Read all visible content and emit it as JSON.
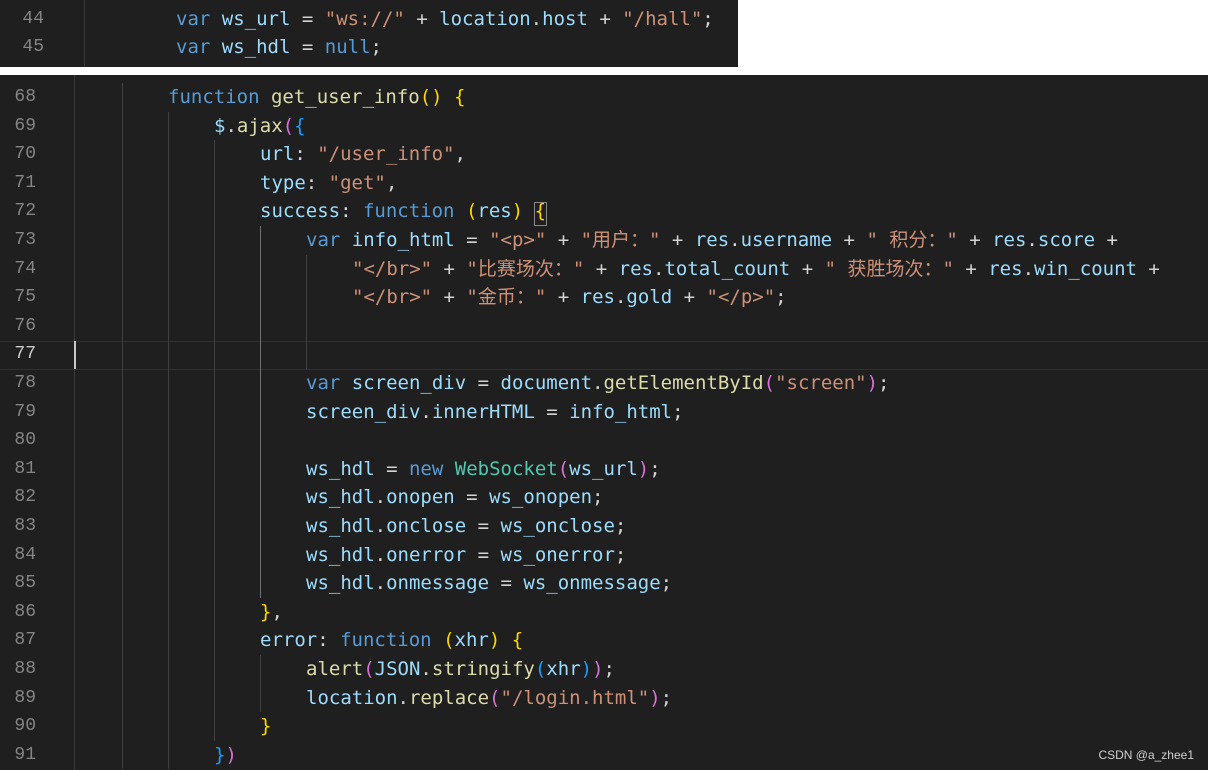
{
  "top_panel": {
    "lines": [
      {
        "n": "44",
        "indent": 8,
        "tokens": [
          {
            "t": "var",
            "c": "kw"
          },
          {
            "t": " "
          },
          {
            "t": "ws_url",
            "c": "var"
          },
          {
            "t": " = "
          },
          {
            "t": "\"ws://\"",
            "c": "str"
          },
          {
            "t": " + "
          },
          {
            "t": "location",
            "c": "var"
          },
          {
            "t": "."
          },
          {
            "t": "host",
            "c": "var"
          },
          {
            "t": " + "
          },
          {
            "t": "\"/hall\"",
            "c": "str"
          },
          {
            "t": ";"
          }
        ]
      },
      {
        "n": "45",
        "indent": 8,
        "tokens": [
          {
            "t": "var",
            "c": "kw"
          },
          {
            "t": " "
          },
          {
            "t": "ws_hdl",
            "c": "var"
          },
          {
            "t": " = "
          },
          {
            "t": "null",
            "c": "kw"
          },
          {
            "t": ";"
          }
        ]
      }
    ]
  },
  "main_panel": {
    "lines": [
      {
        "n": "68",
        "indent": 8,
        "tokens": [
          {
            "t": "function",
            "c": "kw"
          },
          {
            "t": " "
          },
          {
            "t": "get_user_info",
            "c": "fn"
          },
          {
            "t": "()",
            "c": "b1"
          },
          {
            "t": " "
          },
          {
            "t": "{",
            "c": "b1"
          }
        ]
      },
      {
        "n": "69",
        "indent": 12,
        "tokens": [
          {
            "t": "$",
            "c": "var"
          },
          {
            "t": "."
          },
          {
            "t": "ajax",
            "c": "fn"
          },
          {
            "t": "(",
            "c": "b2"
          },
          {
            "t": "{",
            "c": "b3"
          }
        ]
      },
      {
        "n": "70",
        "indent": 16,
        "tokens": [
          {
            "t": "url",
            "c": "var"
          },
          {
            "t": ": "
          },
          {
            "t": "\"/user_info\"",
            "c": "str"
          },
          {
            "t": ","
          }
        ]
      },
      {
        "n": "71",
        "indent": 16,
        "tokens": [
          {
            "t": "type",
            "c": "var"
          },
          {
            "t": ": "
          },
          {
            "t": "\"get\"",
            "c": "str"
          },
          {
            "t": ","
          }
        ]
      },
      {
        "n": "72",
        "indent": 16,
        "tokens": [
          {
            "t": "success",
            "c": "var"
          },
          {
            "t": ": "
          },
          {
            "t": "function",
            "c": "kw"
          },
          {
            "t": " "
          },
          {
            "t": "(",
            "c": "b1"
          },
          {
            "t": "res",
            "c": "var"
          },
          {
            "t": ")",
            "c": "b1"
          },
          {
            "t": " "
          },
          {
            "t": "{",
            "c": "b1",
            "box": true
          }
        ]
      },
      {
        "n": "73",
        "indent": 20,
        "tokens": [
          {
            "t": "var",
            "c": "kw"
          },
          {
            "t": " "
          },
          {
            "t": "info_html",
            "c": "var"
          },
          {
            "t": " = "
          },
          {
            "t": "\"<p>\"",
            "c": "str"
          },
          {
            "t": " + "
          },
          {
            "t": "\"用户：\"",
            "c": "str"
          },
          {
            "t": " + "
          },
          {
            "t": "res",
            "c": "var"
          },
          {
            "t": "."
          },
          {
            "t": "username",
            "c": "var"
          },
          {
            "t": " + "
          },
          {
            "t": "\" 积分：\"",
            "c": "str"
          },
          {
            "t": " + "
          },
          {
            "t": "res",
            "c": "var"
          },
          {
            "t": "."
          },
          {
            "t": "score",
            "c": "var"
          },
          {
            "t": " +"
          }
        ]
      },
      {
        "n": "74",
        "indent": 24,
        "tokens": [
          {
            "t": "\"</br>\"",
            "c": "str"
          },
          {
            "t": " + "
          },
          {
            "t": "\"比赛场次：\"",
            "c": "str"
          },
          {
            "t": " + "
          },
          {
            "t": "res",
            "c": "var"
          },
          {
            "t": "."
          },
          {
            "t": "total_count",
            "c": "var"
          },
          {
            "t": " + "
          },
          {
            "t": "\" 获胜场次：\"",
            "c": "str"
          },
          {
            "t": " + "
          },
          {
            "t": "res",
            "c": "var"
          },
          {
            "t": "."
          },
          {
            "t": "win_count",
            "c": "var"
          },
          {
            "t": " +"
          }
        ]
      },
      {
        "n": "75",
        "indent": 24,
        "tokens": [
          {
            "t": "\"</br>\"",
            "c": "str"
          },
          {
            "t": " + "
          },
          {
            "t": "\"金币：\"",
            "c": "str"
          },
          {
            "t": " + "
          },
          {
            "t": "res",
            "c": "var"
          },
          {
            "t": "."
          },
          {
            "t": "gold",
            "c": "var"
          },
          {
            "t": " + "
          },
          {
            "t": "\"</p>\"",
            "c": "str"
          },
          {
            "t": ";"
          }
        ]
      },
      {
        "n": "76",
        "indent": 0,
        "tokens": []
      },
      {
        "n": "77",
        "indent": 0,
        "tokens": []
      },
      {
        "n": "78",
        "indent": 20,
        "tokens": [
          {
            "t": "var",
            "c": "kw"
          },
          {
            "t": " "
          },
          {
            "t": "screen_div",
            "c": "var"
          },
          {
            "t": " = "
          },
          {
            "t": "document",
            "c": "var"
          },
          {
            "t": "."
          },
          {
            "t": "getElementById",
            "c": "fn"
          },
          {
            "t": "(",
            "c": "b2"
          },
          {
            "t": "\"screen\"",
            "c": "str"
          },
          {
            "t": ")",
            "c": "b2"
          },
          {
            "t": ";"
          }
        ]
      },
      {
        "n": "79",
        "indent": 20,
        "tokens": [
          {
            "t": "screen_div",
            "c": "var"
          },
          {
            "t": "."
          },
          {
            "t": "innerHTML",
            "c": "var"
          },
          {
            "t": " = "
          },
          {
            "t": "info_html",
            "c": "var"
          },
          {
            "t": ";"
          }
        ]
      },
      {
        "n": "80",
        "indent": 0,
        "tokens": []
      },
      {
        "n": "81",
        "indent": 20,
        "tokens": [
          {
            "t": "ws_hdl",
            "c": "var"
          },
          {
            "t": " = "
          },
          {
            "t": "new",
            "c": "kw"
          },
          {
            "t": " "
          },
          {
            "t": "WebSocket",
            "c": "cls"
          },
          {
            "t": "(",
            "c": "b2"
          },
          {
            "t": "ws_url",
            "c": "var"
          },
          {
            "t": ")",
            "c": "b2"
          },
          {
            "t": ";"
          }
        ]
      },
      {
        "n": "82",
        "indent": 20,
        "tokens": [
          {
            "t": "ws_hdl",
            "c": "var"
          },
          {
            "t": "."
          },
          {
            "t": "onopen",
            "c": "var"
          },
          {
            "t": " = "
          },
          {
            "t": "ws_onopen",
            "c": "var"
          },
          {
            "t": ";"
          }
        ]
      },
      {
        "n": "83",
        "indent": 20,
        "tokens": [
          {
            "t": "ws_hdl",
            "c": "var"
          },
          {
            "t": "."
          },
          {
            "t": "onclose",
            "c": "var"
          },
          {
            "t": " = "
          },
          {
            "t": "ws_onclose",
            "c": "var"
          },
          {
            "t": ";"
          }
        ]
      },
      {
        "n": "84",
        "indent": 20,
        "tokens": [
          {
            "t": "ws_hdl",
            "c": "var"
          },
          {
            "t": "."
          },
          {
            "t": "onerror",
            "c": "var"
          },
          {
            "t": " = "
          },
          {
            "t": "ws_onerror",
            "c": "var"
          },
          {
            "t": ";"
          }
        ]
      },
      {
        "n": "85",
        "indent": 20,
        "tokens": [
          {
            "t": "ws_hdl",
            "c": "var"
          },
          {
            "t": "."
          },
          {
            "t": "onmessage",
            "c": "var"
          },
          {
            "t": " = "
          },
          {
            "t": "ws_onmessage",
            "c": "var"
          },
          {
            "t": ";"
          }
        ]
      },
      {
        "n": "86",
        "indent": 16,
        "tokens": [
          {
            "t": "}",
            "c": "b1",
            "box": true
          },
          {
            "t": ","
          }
        ]
      },
      {
        "n": "87",
        "indent": 16,
        "tokens": [
          {
            "t": "error",
            "c": "var"
          },
          {
            "t": ": "
          },
          {
            "t": "function",
            "c": "kw"
          },
          {
            "t": " "
          },
          {
            "t": "(",
            "c": "b1"
          },
          {
            "t": "xhr",
            "c": "var"
          },
          {
            "t": ")",
            "c": "b1"
          },
          {
            "t": " "
          },
          {
            "t": "{",
            "c": "b1"
          }
        ]
      },
      {
        "n": "88",
        "indent": 20,
        "tokens": [
          {
            "t": "alert",
            "c": "fn"
          },
          {
            "t": "(",
            "c": "b2"
          },
          {
            "t": "JSON",
            "c": "var"
          },
          {
            "t": "."
          },
          {
            "t": "stringify",
            "c": "fn"
          },
          {
            "t": "(",
            "c": "b3"
          },
          {
            "t": "xhr",
            "c": "var"
          },
          {
            "t": ")",
            "c": "b3"
          },
          {
            "t": ")",
            "c": "b2"
          },
          {
            "t": ";"
          }
        ]
      },
      {
        "n": "89",
        "indent": 20,
        "tokens": [
          {
            "t": "location",
            "c": "var"
          },
          {
            "t": "."
          },
          {
            "t": "replace",
            "c": "fn"
          },
          {
            "t": "(",
            "c": "b2"
          },
          {
            "t": "\"/login.html\"",
            "c": "str"
          },
          {
            "t": ")",
            "c": "b2"
          },
          {
            "t": ";"
          }
        ]
      },
      {
        "n": "90",
        "indent": 16,
        "tokens": [
          {
            "t": "}",
            "c": "b1"
          }
        ]
      },
      {
        "n": "91",
        "indent": 12,
        "tokens": [
          {
            "t": "}",
            "c": "b3"
          },
          {
            "t": ")",
            "c": "b2"
          }
        ]
      }
    ]
  },
  "watermark": "CSDN @a_zhee1",
  "colors": {
    "background": "#1f1f1f",
    "keyword": "#569cd6",
    "variable": "#9cdcfe",
    "function": "#dcdcaa",
    "string": "#ce9178",
    "class": "#4ec9b0",
    "bracket_gold": "#ffd700",
    "bracket_orchid": "#da70d6",
    "bracket_blue": "#179fff"
  }
}
